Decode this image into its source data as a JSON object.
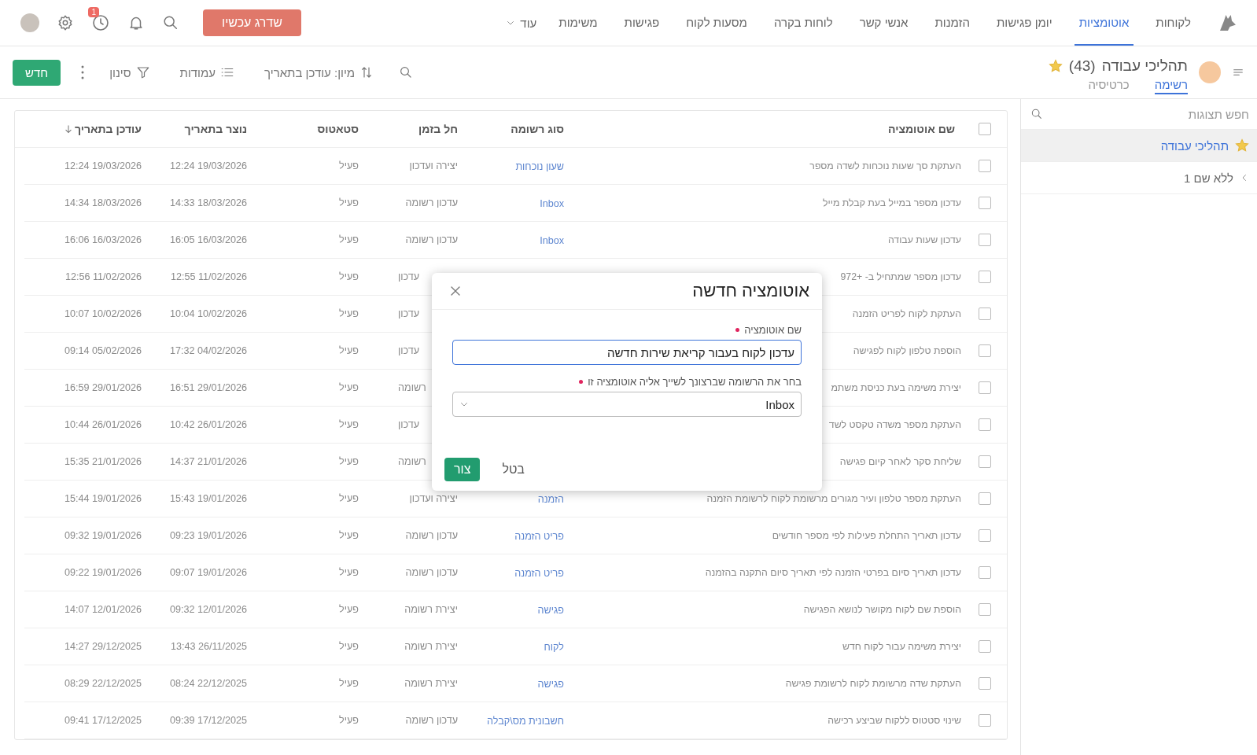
{
  "nav": {
    "items": [
      {
        "label": "לקוחות",
        "selected": false
      },
      {
        "label": "אוטומציות",
        "selected": true
      },
      {
        "label": "יומן פגישות",
        "selected": false
      },
      {
        "label": "הזמנות",
        "selected": false
      },
      {
        "label": "אנשי קשר",
        "selected": false
      },
      {
        "label": "לוחות בקרה",
        "selected": false
      },
      {
        "label": "מסעות לקוח",
        "selected": false
      },
      {
        "label": "פגישות",
        "selected": false
      },
      {
        "label": "משימות",
        "selected": false
      }
    ],
    "more": "עוד",
    "upgrade_button": "שדרג עכשיו",
    "notification_count": "1"
  },
  "header": {
    "title": "תהליכי עבודה",
    "count": "(43)",
    "favorite": true,
    "tabs": [
      {
        "label": "רשימה",
        "selected": true
      },
      {
        "label": "כרטיסיה",
        "selected": false
      }
    ]
  },
  "toolbar": {
    "sort": "מיון: עודכן בתאריך",
    "columns": "עמודות",
    "filter": "סינון",
    "new_button": "חדש"
  },
  "sidebar": {
    "search_placeholder": "חפש תצוגות",
    "items": [
      {
        "kind": "view",
        "label": "תהליכי עבודה",
        "favorite": true,
        "selected": true
      },
      {
        "kind": "folder",
        "label": "ללא שם 1",
        "expanded": false,
        "selected": false
      }
    ]
  },
  "table": {
    "all_checked": false,
    "columns": [
      {
        "label": "שם אוטומציה"
      },
      {
        "label": "סוג רשומה"
      },
      {
        "label": "חל בזמן"
      },
      {
        "label": "סטאטוס"
      },
      {
        "label": "נוצר בתאריך"
      },
      {
        "label": "עודכן בתאריך",
        "sorted_descending": true
      }
    ],
    "rows": [
      {
        "checked": false,
        "partly_covered": false,
        "name": "העתקת סך שעות נוכחות לשדה מספר",
        "type": "שעון נוכחות",
        "trigger": "יצירה ועדכון",
        "status": "פעיל",
        "created": "19/03/2026 12:24",
        "updated": "19/03/2026 12:24"
      },
      {
        "checked": false,
        "partly_covered": false,
        "name": "עדכון מספר במייל בעת קבלת מייל",
        "type": "Inbox",
        "trigger": "עדכון רשומה",
        "status": "פעיל",
        "created": "18/03/2026 14:33",
        "updated": "18/03/2026 14:34"
      },
      {
        "checked": false,
        "partly_covered": false,
        "name": "עדכון שעות עבודה",
        "type": "Inbox",
        "trigger": "עדכון רשומה",
        "status": "פעיל",
        "created": "16/03/2026 16:05",
        "updated": "16/03/2026 16:06"
      },
      {
        "checked": false,
        "partly_covered": true,
        "name": "עדכון מספר שמתחיל ב- +972",
        "trigger": "עדכון",
        "status": "פעיל",
        "created": "11/02/2026 12:55",
        "updated": "11/02/2026 12:56"
      },
      {
        "checked": false,
        "partly_covered": true,
        "name": "העתקת לקוח לפריט הזמנה",
        "trigger": "עדכון",
        "status": "פעיל",
        "created": "10/02/2026 10:04",
        "updated": "10/02/2026 10:07"
      },
      {
        "checked": false,
        "partly_covered": true,
        "name": "הוספת טלפון לקוח לפגישה",
        "trigger": "עדכון",
        "status": "פעיל",
        "created": "04/02/2026 17:32",
        "updated": "05/02/2026 09:14"
      },
      {
        "checked": false,
        "partly_covered": true,
        "name": "יצירת משימה בעת כניסת משתמ",
        "trigger": "רשומה",
        "status": "פעיל",
        "created": "29/01/2026 16:51",
        "updated": "29/01/2026 16:59"
      },
      {
        "checked": false,
        "partly_covered": true,
        "name": "העתקת מספר משדה טקסט לשד",
        "trigger": "עדכון",
        "status": "פעיל",
        "created": "26/01/2026 10:42",
        "updated": "26/01/2026 10:44"
      },
      {
        "checked": false,
        "partly_covered": true,
        "name": "שליחת סקר לאחר קיום פגישה",
        "trigger": "רשומה",
        "status": "פעיל",
        "created": "21/01/2026 14:37",
        "updated": "21/01/2026 15:35"
      },
      {
        "checked": false,
        "partly_covered": false,
        "name": "העתקת מספר טלפון ועיר מגורים מרשומת לקוח לרשומת הזמנה",
        "type": "הזמנה",
        "trigger": "יצירה ועדכון",
        "status": "פעיל",
        "created": "19/01/2026 15:43",
        "updated": "19/01/2026 15:44"
      },
      {
        "checked": false,
        "partly_covered": false,
        "name": "עדכון תאריך התחלת פעילות לפי מספר חודשים",
        "type": "פריט הזמנה",
        "trigger": "עדכון רשומה",
        "status": "פעיל",
        "created": "19/01/2026 09:23",
        "updated": "19/01/2026 09:32"
      },
      {
        "checked": false,
        "partly_covered": false,
        "name": "עדכון תאריך סיום בפרטי הזמנה לפי תאריך סיום התקנה בהזמנה",
        "type": "פריט הזמנה",
        "trigger": "עדכון רשומה",
        "status": "פעיל",
        "created": "19/01/2026 09:07",
        "updated": "19/01/2026 09:22"
      },
      {
        "checked": false,
        "partly_covered": false,
        "name": "הוספת שם לקוח מקושר לנושא הפגישה",
        "type": "פגישה",
        "trigger": "יצירת רשומה",
        "status": "פעיל",
        "created": "12/01/2026 09:32",
        "updated": "12/01/2026 14:07"
      },
      {
        "checked": false,
        "partly_covered": false,
        "name": "יצירת משימה עבור לקוח חדש",
        "type": "לקוח",
        "trigger": "יצירת רשומה",
        "status": "פעיל",
        "created": "26/11/2025 13:43",
        "updated": "29/12/2025 14:27"
      },
      {
        "checked": false,
        "partly_covered": false,
        "name": "העתקת שדה מרשומת לקוח לרשומת פגישה",
        "type": "פגישה",
        "trigger": "יצירת רשומה",
        "status": "פעיל",
        "created": "22/12/2025 08:24",
        "updated": "22/12/2025 08:29"
      },
      {
        "checked": false,
        "partly_covered": false,
        "name": "שינוי סטטוס ללקוח שביצע רכישה",
        "type": "חשבונית מס\\קבלה",
        "trigger": "עדכון רשומה",
        "status": "פעיל",
        "created": "17/12/2025 09:39",
        "updated": "17/12/2025 09:41"
      }
    ]
  },
  "dialog": {
    "title": "אוטומציה חדשה",
    "fields": [
      {
        "kind": "text",
        "label": "שם אוטומציה",
        "required": true,
        "focused": true,
        "value": "עדכון לקוח בעבור קריאת שירות חדשה"
      },
      {
        "kind": "select",
        "label": "בחר את הרשומה שברצונך לשייך אליה אוטומציה זו",
        "required": true,
        "focused": false,
        "value": "Inbox"
      }
    ],
    "buttons": [
      {
        "kind": "secondary",
        "label": "בטל"
      },
      {
        "kind": "primary",
        "label": "צור"
      }
    ]
  }
}
